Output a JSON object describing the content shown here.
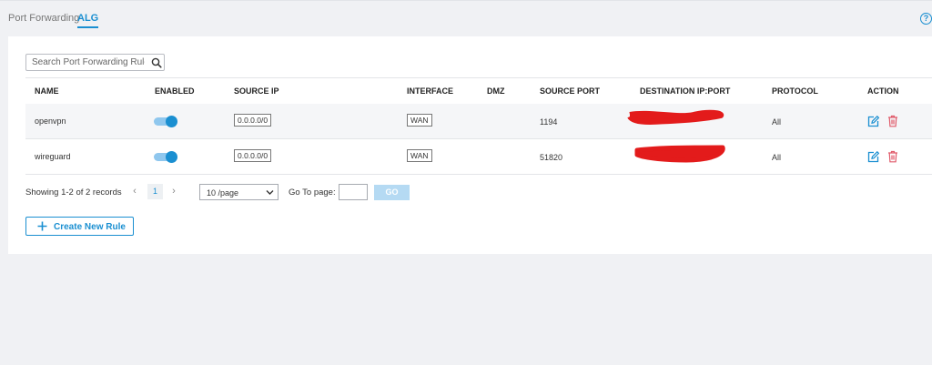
{
  "tabs": [
    {
      "label": "Port Forwarding",
      "active": false
    },
    {
      "label": "ALG",
      "active": true
    }
  ],
  "help_icon": "question-circle-icon",
  "search": {
    "placeholder": "Search Port Forwarding Rule",
    "value": "",
    "icon": "search-icon"
  },
  "table": {
    "columns": [
      "NAME",
      "ENABLED",
      "SOURCE IP",
      "INTERFACE",
      "DMZ",
      "SOURCE PORT",
      "DESTINATION IP:PORT",
      "PROTOCOL",
      "ACTION"
    ],
    "rows": [
      {
        "name": "openvpn",
        "enabled": true,
        "source_ip": "0.0.0.0/0",
        "interface": "WAN",
        "dmz": "",
        "source_port": "1194",
        "destination": "",
        "protocol": "All",
        "actions": [
          "edit-icon",
          "delete-icon"
        ]
      },
      {
        "name": "wireguard",
        "enabled": true,
        "source_ip": "0.0.0.0/0",
        "interface": "WAN",
        "dmz": "",
        "source_port": "51820",
        "destination": "",
        "protocol": "All",
        "actions": [
          "edit-icon",
          "delete-icon"
        ]
      }
    ]
  },
  "pagination": {
    "summary": "Showing 1-2 of 2 records",
    "current_page": "1",
    "page_size": "10 /page",
    "goto_label": "Go To page:",
    "goto_value": "",
    "go_label": "GO"
  },
  "create_button": {
    "label": "Create New Rule",
    "icon": "plus-icon"
  },
  "colors": {
    "accent": "#1a8fd1",
    "toggle_track": "#8fc7ee",
    "delete": "#e05a6a",
    "redaction": "#e31b1b"
  }
}
